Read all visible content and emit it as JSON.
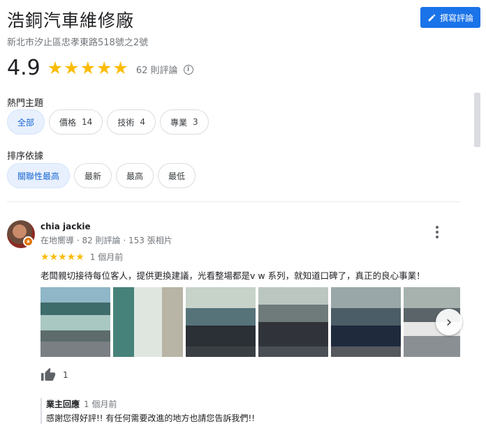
{
  "place": {
    "title": "浩銅汽車維修廠",
    "address": "新北市汐止區忠孝東路518號之2號",
    "rating": "4.9",
    "review_count": "62 則評論"
  },
  "write_review_label": "撰寫評論",
  "topics": {
    "label": "熱門主題",
    "chips": [
      {
        "label": "全部",
        "count": ""
      },
      {
        "label": "價格",
        "count": "14"
      },
      {
        "label": "技術",
        "count": "4"
      },
      {
        "label": "專業",
        "count": "3"
      }
    ]
  },
  "sort": {
    "label": "排序依據",
    "chips": [
      "關聯性最高",
      "最新",
      "最高",
      "最低"
    ]
  },
  "review": {
    "author": "chia jackie",
    "meta": "在地嚮導 · 82 則評論 · 153 張相片",
    "stars": 5,
    "time": "1 個月前",
    "text": "老闆親切接待每位客人，提供更換建議，光看整場都是v w 系列，就知道口碑了，真正的良心事業！",
    "likes": "1",
    "owner_reply": {
      "label": "業主回應",
      "time": "1 個月前",
      "text": "感謝您得好評!! 有任何需要改進的地方也請您告訴我們!!"
    }
  },
  "colors": {
    "accent": "#1a73e8",
    "star": "#fbbc04",
    "chip_active_bg": "#e8f0fe"
  }
}
